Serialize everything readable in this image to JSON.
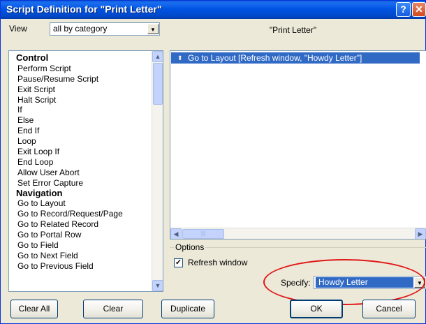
{
  "window": {
    "title": "Script Definition for \"Print Letter\""
  },
  "view": {
    "label": "View",
    "selected": "all by category"
  },
  "script_name": "\"Print Letter\"",
  "steps": [
    {
      "label": "Control",
      "category": true
    },
    {
      "label": "Perform Script"
    },
    {
      "label": "Pause/Resume Script"
    },
    {
      "label": "Exit Script"
    },
    {
      "label": "Halt Script"
    },
    {
      "label": "If"
    },
    {
      "label": "Else"
    },
    {
      "label": "End If"
    },
    {
      "label": "Loop"
    },
    {
      "label": "Exit Loop If"
    },
    {
      "label": "End Loop"
    },
    {
      "label": "Allow User Abort"
    },
    {
      "label": "Set Error Capture"
    },
    {
      "label": "Navigation",
      "category": true
    },
    {
      "label": "Go to Layout"
    },
    {
      "label": "Go to Record/Request/Page"
    },
    {
      "label": "Go to Related Record"
    },
    {
      "label": "Go to Portal Row"
    },
    {
      "label": "Go to Field"
    },
    {
      "label": "Go to Next Field"
    },
    {
      "label": "Go to Previous Field"
    }
  ],
  "script_steps": [
    {
      "text": "Go to Layout [Refresh window, \"Howdy Letter\"]",
      "selected": true
    }
  ],
  "options": {
    "label": "Options",
    "refresh_window_label": "Refresh window",
    "refresh_window_checked": true,
    "specify_label": "Specify:",
    "specify_value": "Howdy Letter"
  },
  "buttons": {
    "clear_all": "Clear All",
    "clear": "Clear",
    "duplicate": "Duplicate",
    "ok": "OK",
    "cancel": "Cancel"
  },
  "colors": {
    "selection": "#316ac5",
    "annotation": "#e01818",
    "title_bar": "#0054e3"
  }
}
